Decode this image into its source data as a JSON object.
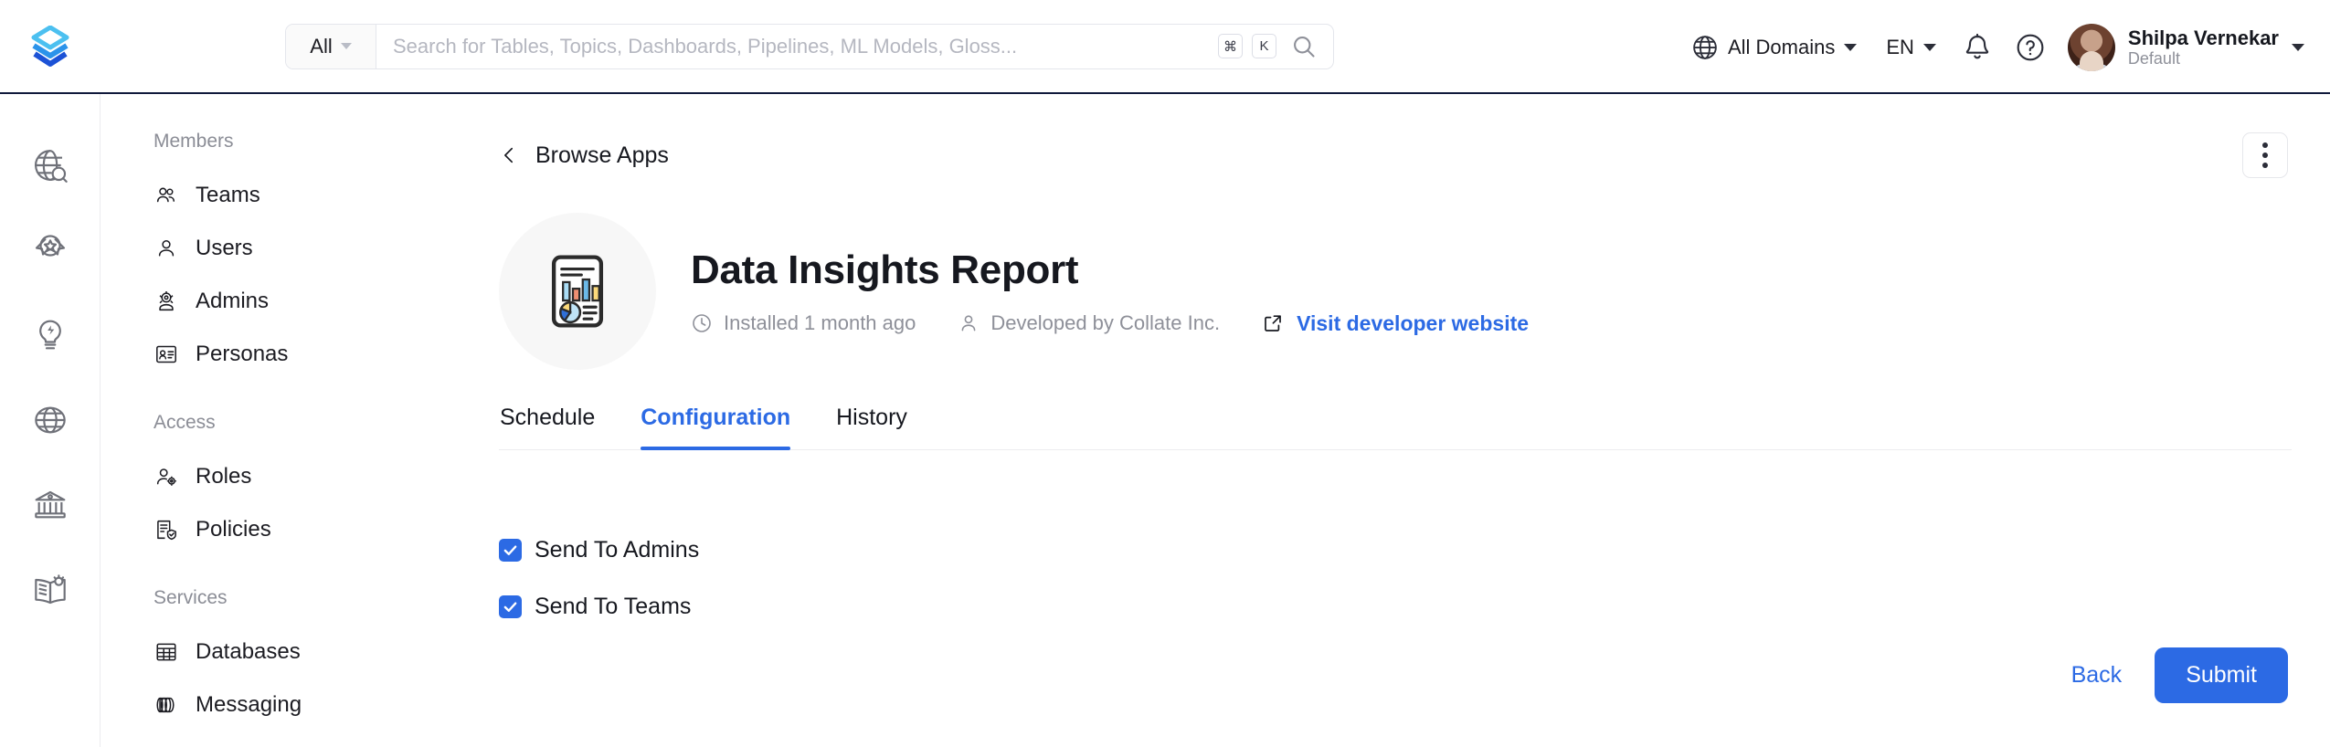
{
  "header": {
    "logo_name": "collate-logo",
    "search": {
      "scope_label": "All",
      "placeholder": "Search for Tables, Topics, Dashboards, Pipelines, ML Models, Gloss...",
      "value": "",
      "shortcut_modifier": "⌘",
      "shortcut_key": "K"
    },
    "domain_selector": "All Domains",
    "language_selector": "EN",
    "user": {
      "name": "Shilpa Vernekar",
      "role": "Default"
    }
  },
  "icon_rail": [
    {
      "name": "explore-icon",
      "title": "Explore"
    },
    {
      "name": "quality-icon",
      "title": "Data Quality"
    },
    {
      "name": "insights-icon",
      "title": "Insights"
    },
    {
      "name": "domains-icon",
      "title": "Domains"
    },
    {
      "name": "governance-icon",
      "title": "Governance"
    },
    {
      "name": "glossary-icon",
      "title": "Glossary"
    }
  ],
  "sidebar": {
    "groups": [
      {
        "title": "Members",
        "items": [
          {
            "label": "Teams",
            "icon": "teams-icon"
          },
          {
            "label": "Users",
            "icon": "user-icon"
          },
          {
            "label": "Admins",
            "icon": "admin-icon"
          },
          {
            "label": "Personas",
            "icon": "persona-icon"
          }
        ]
      },
      {
        "title": "Access",
        "items": [
          {
            "label": "Roles",
            "icon": "roles-icon"
          },
          {
            "label": "Policies",
            "icon": "policies-icon"
          }
        ]
      },
      {
        "title": "Services",
        "items": [
          {
            "label": "Databases",
            "icon": "database-icon"
          },
          {
            "label": "Messaging",
            "icon": "messaging-icon"
          }
        ]
      }
    ]
  },
  "main": {
    "breadcrumb": "Browse Apps",
    "kebab_menu_label": "More actions",
    "app": {
      "name": "Data Insights Report",
      "icon_name": "report-chart-icon",
      "installed_text": "Installed 1 month ago",
      "developer_text": "Developed by Collate Inc.",
      "website_link": "Visit developer website"
    },
    "tabs": [
      {
        "label": "Schedule",
        "active": false
      },
      {
        "label": "Configuration",
        "active": true
      },
      {
        "label": "History",
        "active": false
      }
    ],
    "configuration": {
      "checkboxes": [
        {
          "label": "Send To Admins",
          "checked": true
        },
        {
          "label": "Send To Teams",
          "checked": true
        }
      ]
    },
    "actions": {
      "back_label": "Back",
      "submit_label": "Submit"
    }
  },
  "colors": {
    "accent": "#2c6ae4",
    "header_border": "#10193b",
    "muted_text": "#8e9099",
    "app_icon_bg": "#f7f7f7"
  }
}
